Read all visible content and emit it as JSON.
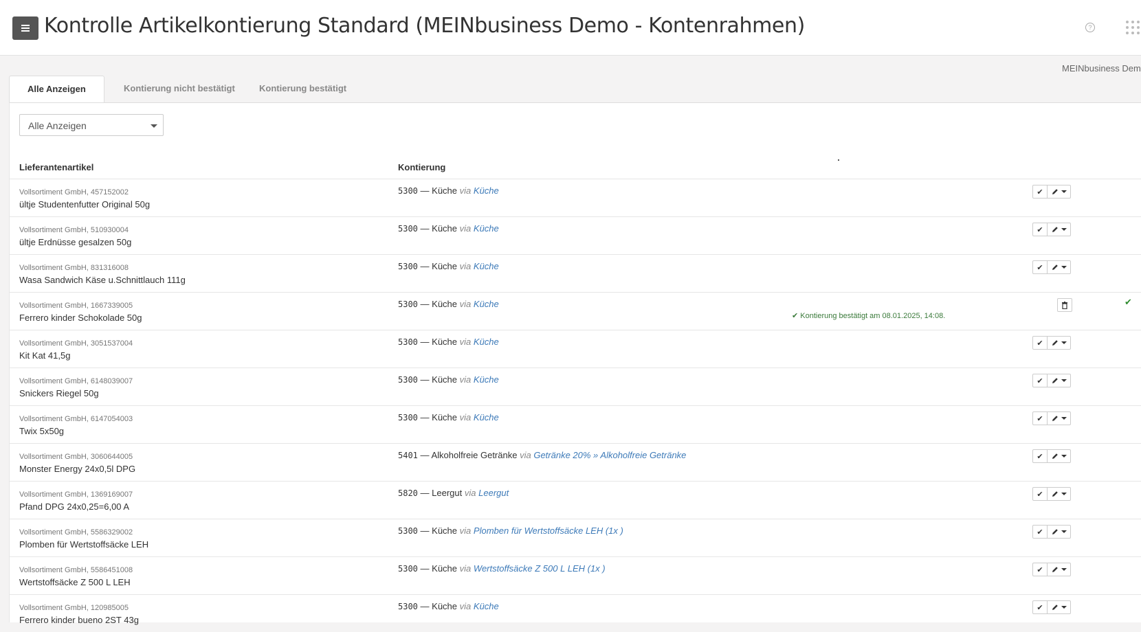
{
  "header": {
    "title": "Kontrolle Artikelkontierung Standard (MEINbusiness Demo - Kontenrahmen)",
    "help_glyph": "?",
    "company": "MEINbusiness Demo"
  },
  "tabs": [
    {
      "label": "Alle Anzeigen",
      "active": true
    },
    {
      "label": "Kontierung nicht bestätigt",
      "active": false
    },
    {
      "label": "Kontierung bestätigt",
      "active": false
    }
  ],
  "filter": {
    "selected": "Alle Anzeigen"
  },
  "table": {
    "columns": [
      "Lieferantenartikel",
      "Kontierung"
    ],
    "rows": [
      {
        "supplier": "Vollsortiment GmbH, 457152002",
        "article": "ültje Studentenfutter Original 50g",
        "code": "5300",
        "account": "Küche",
        "via": "via",
        "via_target": "Küche"
      },
      {
        "supplier": "Vollsortiment GmbH, 510930004",
        "article": "ültje Erdnüsse gesalzen 50g",
        "code": "5300",
        "account": "Küche",
        "via": "via",
        "via_target": "Küche"
      },
      {
        "supplier": "Vollsortiment GmbH, 831316008",
        "article": "Wasa Sandwich Käse u.Schnittlauch 111g",
        "code": "5300",
        "account": "Küche",
        "via": "via",
        "via_target": "Küche"
      },
      {
        "supplier": "Vollsortiment GmbH, 1667339005",
        "article": "Ferrero kinder Schokolade 50g",
        "code": "5300",
        "account": "Küche",
        "via": "via",
        "via_target": "Küche",
        "confirmed": true,
        "confirmed_text": "Kontierung bestätigt am 08.01.2025, 14:08."
      },
      {
        "supplier": "Vollsortiment GmbH, 3051537004",
        "article": "Kit Kat 41,5g",
        "code": "5300",
        "account": "Küche",
        "via": "via",
        "via_target": "Küche"
      },
      {
        "supplier": "Vollsortiment GmbH, 6148039007",
        "article": "Snickers Riegel 50g",
        "code": "5300",
        "account": "Küche",
        "via": "via",
        "via_target": "Küche"
      },
      {
        "supplier": "Vollsortiment GmbH, 6147054003",
        "article": "Twix 5x50g",
        "code": "5300",
        "account": "Küche",
        "via": "via",
        "via_target": "Küche"
      },
      {
        "supplier": "Vollsortiment GmbH, 3060644005",
        "article": "Monster Energy 24x0,5l DPG",
        "code": "5401",
        "account": "Alkoholfreie Getränke",
        "via": "via",
        "via_target": "Getränke 20% » Alkoholfreie Getränke"
      },
      {
        "supplier": "Vollsortiment GmbH, 1369169007",
        "article": "Pfand DPG 24x0,25=6,00 A",
        "code": "5820",
        "account": "Leergut",
        "via": "via",
        "via_target": "Leergut"
      },
      {
        "supplier": "Vollsortiment GmbH, 5586329002",
        "article": "Plomben für Wertstoffsäcke LEH",
        "code": "5300",
        "account": "Küche",
        "via": "via",
        "via_target": "Plomben für Wertstoffsäcke LEH (1x )"
      },
      {
        "supplier": "Vollsortiment GmbH, 5586451008",
        "article": "Wertstoffsäcke Z 500 L LEH",
        "code": "5300",
        "account": "Küche",
        "via": "via",
        "via_target": "Wertstoffsäcke Z 500 L LEH (1x )"
      },
      {
        "supplier": "Vollsortiment GmbH, 120985005",
        "article": "Ferrero kinder bueno 2ST 43g",
        "code": "5300",
        "account": "Küche",
        "via": "via",
        "via_target": "Küche"
      }
    ]
  },
  "icons": {
    "confirm": "check-icon",
    "edit": "pencil-icon",
    "delete": "trash-icon",
    "confirmed": "check-icon"
  },
  "colors": {
    "link": "#3d7ab8",
    "confirmed": "#2e8b2e",
    "menu_button": "#555555"
  }
}
